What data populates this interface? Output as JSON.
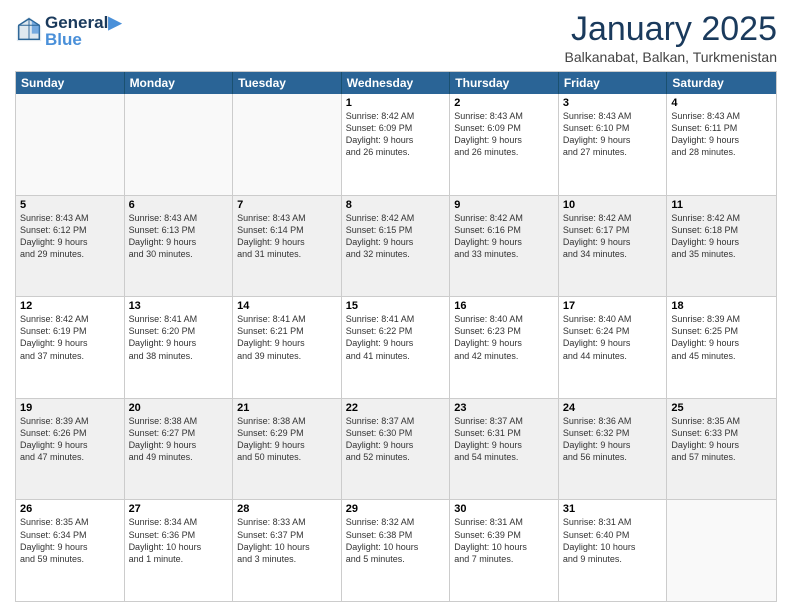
{
  "header": {
    "logo_line1": "General",
    "logo_line2": "Blue",
    "month": "January 2025",
    "location": "Balkanabat, Balkan, Turkmenistan"
  },
  "weekdays": [
    "Sunday",
    "Monday",
    "Tuesday",
    "Wednesday",
    "Thursday",
    "Friday",
    "Saturday"
  ],
  "rows": [
    [
      {
        "day": "",
        "info": ""
      },
      {
        "day": "",
        "info": ""
      },
      {
        "day": "",
        "info": ""
      },
      {
        "day": "1",
        "info": "Sunrise: 8:42 AM\nSunset: 6:09 PM\nDaylight: 9 hours\nand 26 minutes."
      },
      {
        "day": "2",
        "info": "Sunrise: 8:43 AM\nSunset: 6:09 PM\nDaylight: 9 hours\nand 26 minutes."
      },
      {
        "day": "3",
        "info": "Sunrise: 8:43 AM\nSunset: 6:10 PM\nDaylight: 9 hours\nand 27 minutes."
      },
      {
        "day": "4",
        "info": "Sunrise: 8:43 AM\nSunset: 6:11 PM\nDaylight: 9 hours\nand 28 minutes."
      }
    ],
    [
      {
        "day": "5",
        "info": "Sunrise: 8:43 AM\nSunset: 6:12 PM\nDaylight: 9 hours\nand 29 minutes."
      },
      {
        "day": "6",
        "info": "Sunrise: 8:43 AM\nSunset: 6:13 PM\nDaylight: 9 hours\nand 30 minutes."
      },
      {
        "day": "7",
        "info": "Sunrise: 8:43 AM\nSunset: 6:14 PM\nDaylight: 9 hours\nand 31 minutes."
      },
      {
        "day": "8",
        "info": "Sunrise: 8:42 AM\nSunset: 6:15 PM\nDaylight: 9 hours\nand 32 minutes."
      },
      {
        "day": "9",
        "info": "Sunrise: 8:42 AM\nSunset: 6:16 PM\nDaylight: 9 hours\nand 33 minutes."
      },
      {
        "day": "10",
        "info": "Sunrise: 8:42 AM\nSunset: 6:17 PM\nDaylight: 9 hours\nand 34 minutes."
      },
      {
        "day": "11",
        "info": "Sunrise: 8:42 AM\nSunset: 6:18 PM\nDaylight: 9 hours\nand 35 minutes."
      }
    ],
    [
      {
        "day": "12",
        "info": "Sunrise: 8:42 AM\nSunset: 6:19 PM\nDaylight: 9 hours\nand 37 minutes."
      },
      {
        "day": "13",
        "info": "Sunrise: 8:41 AM\nSunset: 6:20 PM\nDaylight: 9 hours\nand 38 minutes."
      },
      {
        "day": "14",
        "info": "Sunrise: 8:41 AM\nSunset: 6:21 PM\nDaylight: 9 hours\nand 39 minutes."
      },
      {
        "day": "15",
        "info": "Sunrise: 8:41 AM\nSunset: 6:22 PM\nDaylight: 9 hours\nand 41 minutes."
      },
      {
        "day": "16",
        "info": "Sunrise: 8:40 AM\nSunset: 6:23 PM\nDaylight: 9 hours\nand 42 minutes."
      },
      {
        "day": "17",
        "info": "Sunrise: 8:40 AM\nSunset: 6:24 PM\nDaylight: 9 hours\nand 44 minutes."
      },
      {
        "day": "18",
        "info": "Sunrise: 8:39 AM\nSunset: 6:25 PM\nDaylight: 9 hours\nand 45 minutes."
      }
    ],
    [
      {
        "day": "19",
        "info": "Sunrise: 8:39 AM\nSunset: 6:26 PM\nDaylight: 9 hours\nand 47 minutes."
      },
      {
        "day": "20",
        "info": "Sunrise: 8:38 AM\nSunset: 6:27 PM\nDaylight: 9 hours\nand 49 minutes."
      },
      {
        "day": "21",
        "info": "Sunrise: 8:38 AM\nSunset: 6:29 PM\nDaylight: 9 hours\nand 50 minutes."
      },
      {
        "day": "22",
        "info": "Sunrise: 8:37 AM\nSunset: 6:30 PM\nDaylight: 9 hours\nand 52 minutes."
      },
      {
        "day": "23",
        "info": "Sunrise: 8:37 AM\nSunset: 6:31 PM\nDaylight: 9 hours\nand 54 minutes."
      },
      {
        "day": "24",
        "info": "Sunrise: 8:36 AM\nSunset: 6:32 PM\nDaylight: 9 hours\nand 56 minutes."
      },
      {
        "day": "25",
        "info": "Sunrise: 8:35 AM\nSunset: 6:33 PM\nDaylight: 9 hours\nand 57 minutes."
      }
    ],
    [
      {
        "day": "26",
        "info": "Sunrise: 8:35 AM\nSunset: 6:34 PM\nDaylight: 9 hours\nand 59 minutes."
      },
      {
        "day": "27",
        "info": "Sunrise: 8:34 AM\nSunset: 6:36 PM\nDaylight: 10 hours\nand 1 minute."
      },
      {
        "day": "28",
        "info": "Sunrise: 8:33 AM\nSunset: 6:37 PM\nDaylight: 10 hours\nand 3 minutes."
      },
      {
        "day": "29",
        "info": "Sunrise: 8:32 AM\nSunset: 6:38 PM\nDaylight: 10 hours\nand 5 minutes."
      },
      {
        "day": "30",
        "info": "Sunrise: 8:31 AM\nSunset: 6:39 PM\nDaylight: 10 hours\nand 7 minutes."
      },
      {
        "day": "31",
        "info": "Sunrise: 8:31 AM\nSunset: 6:40 PM\nDaylight: 10 hours\nand 9 minutes."
      },
      {
        "day": "",
        "info": ""
      }
    ]
  ]
}
